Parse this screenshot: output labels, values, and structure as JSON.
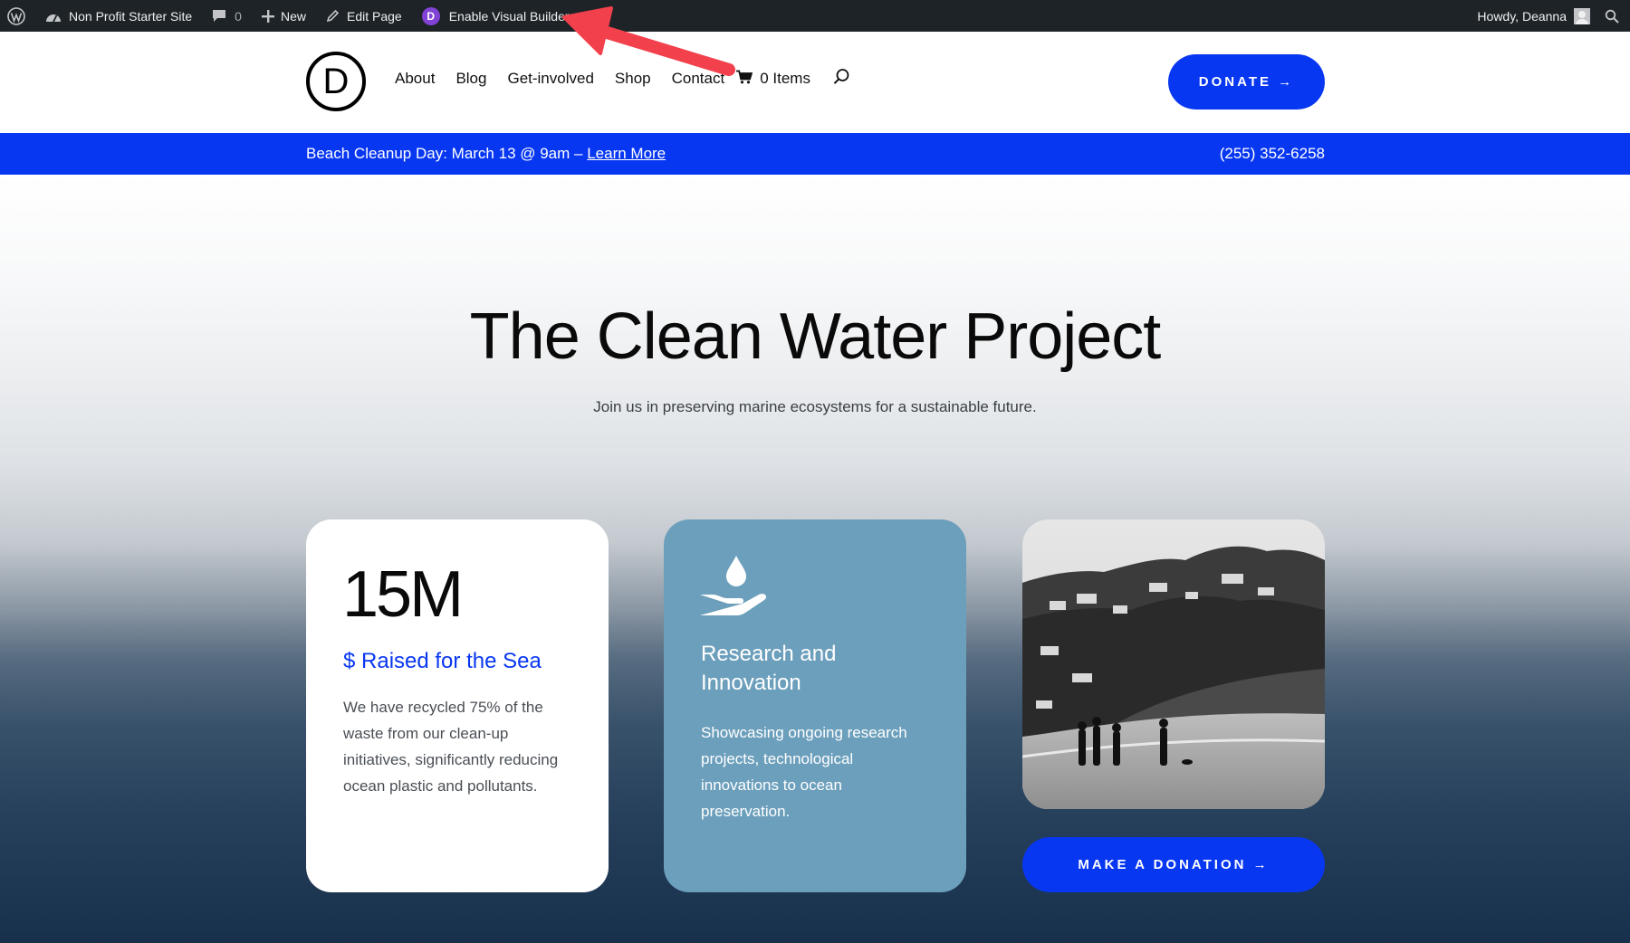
{
  "admin_bar": {
    "site_name": "Non Profit Starter Site",
    "comments_count": "0",
    "new_label": "New",
    "edit_page_label": "Edit Page",
    "visual_builder_label": "Enable Visual Builder",
    "divi_letter": "D",
    "greeting": "Howdy, Deanna"
  },
  "header": {
    "logo_letter": "D",
    "nav": [
      "About",
      "Blog",
      "Get-involved",
      "Shop",
      "Contact"
    ],
    "cart_label": "0 Items",
    "donate_label": "DONATE →"
  },
  "announcement": {
    "text": "Beach Cleanup Day: March 13 @ 9am – ",
    "link": "Learn More",
    "phone": "(255) 352-6258"
  },
  "hero": {
    "title": "The Clean Water Project",
    "subtitle": "Join us in preserving marine ecosystems for a sustainable future."
  },
  "cards": {
    "stat": {
      "number": "15M",
      "heading": "$ Raised for the Sea",
      "body": "We have recycled 75% of the waste from our clean-up initiatives, significantly reducing ocean plastic and pollutants."
    },
    "research": {
      "heading": "Research and Innovation",
      "body": "Showcasing ongoing research projects, technological innovations to ocean preservation."
    },
    "donation_button": "MAKE A DONATION →"
  },
  "colors": {
    "brand_blue": "#0837f2",
    "card_blue": "#6c9fbc",
    "admin_bar": "#1d2327",
    "annotation_arrow": "#f2414c"
  }
}
